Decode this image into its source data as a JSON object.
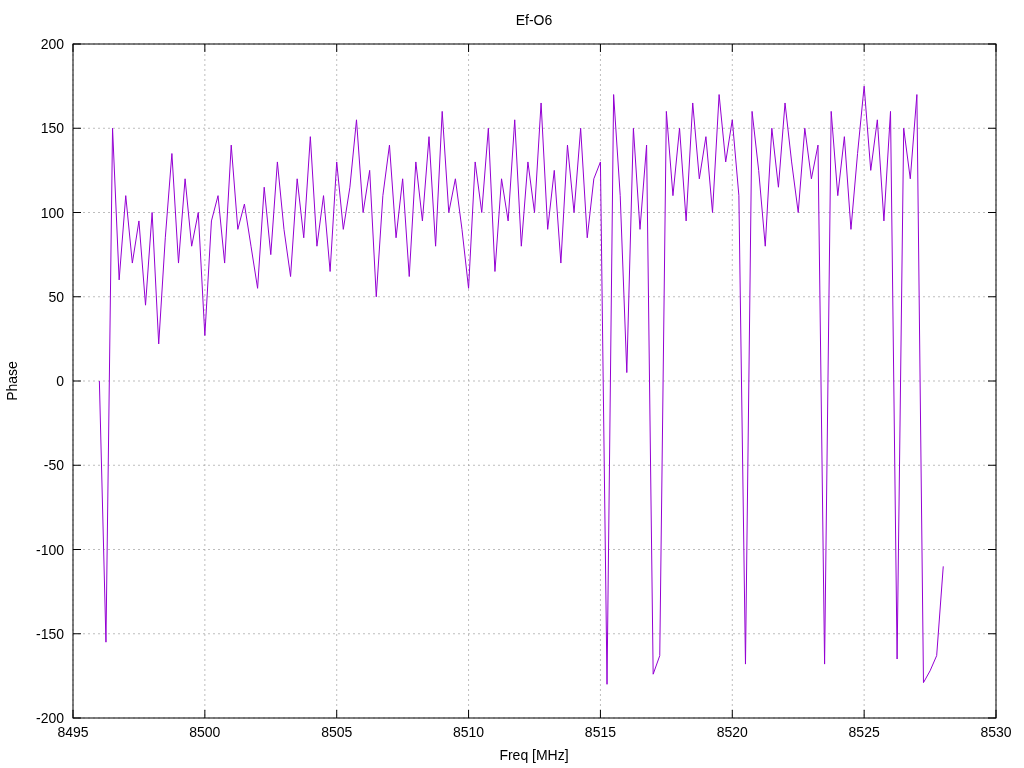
{
  "chart": {
    "chart_data": {
      "type": "line",
      "title": "Ef-O6",
      "xlabel": "Freq [MHz]",
      "ylabel": "Phase",
      "xlim": [
        8495,
        8530
      ],
      "ylim": [
        -200,
        200
      ],
      "xticks": [
        8495,
        8500,
        8505,
        8510,
        8515,
        8520,
        8525,
        8530
      ],
      "yticks": [
        -200,
        -150,
        -100,
        -50,
        0,
        50,
        100,
        150,
        200
      ],
      "x": [
        8496,
        8496.25,
        8496.5,
        8496.75,
        8497,
        8497.25,
        8497.5,
        8497.75,
        8498,
        8498.25,
        8498.5,
        8498.75,
        8499,
        8499.25,
        8499.5,
        8499.75,
        8500,
        8500.25,
        8500.5,
        8500.75,
        8501,
        8501.25,
        8501.5,
        8501.75,
        8502,
        8502.25,
        8502.5,
        8502.75,
        8503,
        8503.25,
        8503.5,
        8503.75,
        8504,
        8504.25,
        8504.5,
        8504.75,
        8505,
        8505.25,
        8505.5,
        8505.75,
        8506,
        8506.25,
        8506.5,
        8506.75,
        8507,
        8507.25,
        8507.5,
        8507.75,
        8508,
        8508.25,
        8508.5,
        8508.75,
        8509,
        8509.25,
        8509.5,
        8509.75,
        8510,
        8510.25,
        8510.5,
        8510.75,
        8511,
        8511.25,
        8511.5,
        8511.75,
        8512,
        8512.25,
        8512.5,
        8512.75,
        8513,
        8513.25,
        8513.5,
        8513.75,
        8514,
        8514.25,
        8514.5,
        8514.75,
        8515,
        8515.25,
        8515.5,
        8515.75,
        8516,
        8516.25,
        8516.5,
        8516.75,
        8517,
        8517.25,
        8517.5,
        8517.75,
        8518,
        8518.25,
        8518.5,
        8518.75,
        8519,
        8519.25,
        8519.5,
        8519.75,
        8520,
        8520.25,
        8520.5,
        8520.75,
        8521,
        8521.25,
        8521.5,
        8521.75,
        8522,
        8522.25,
        8522.5,
        8522.75,
        8523,
        8523.25,
        8523.5,
        8523.75,
        8524,
        8524.25,
        8524.5,
        8524.75,
        8525,
        8525.25,
        8525.5,
        8525.75,
        8526,
        8526.25,
        8526.5,
        8526.75,
        8527,
        8527.25,
        8527.5,
        8527.75,
        8528
      ],
      "grid": true,
      "series": [
        {
          "color": "#9400d3",
          "values": [
            0,
            -155,
            150,
            60,
            110,
            70,
            95,
            45,
            100,
            22,
            85,
            135,
            70,
            120,
            80,
            100,
            27,
            95,
            110,
            70,
            140,
            90,
            105,
            80,
            55,
            115,
            75,
            130,
            90,
            62,
            120,
            85,
            145,
            80,
            110,
            65,
            130,
            90,
            115,
            155,
            100,
            125,
            50,
            110,
            140,
            85,
            120,
            62,
            130,
            95,
            145,
            80,
            160,
            100,
            120,
            90,
            55,
            130,
            100,
            150,
            65,
            120,
            95,
            155,
            80,
            130,
            100,
            165,
            90,
            125,
            70,
            140,
            100,
            150,
            85,
            120,
            130,
            -180,
            170,
            110,
            5,
            150,
            90,
            140,
            -174,
            -163,
            160,
            110,
            150,
            95,
            165,
            120,
            145,
            100,
            170,
            130,
            155,
            110,
            -168,
            160,
            125,
            80,
            150,
            115,
            165,
            130,
            100,
            150,
            120,
            140,
            -168,
            160,
            110,
            145,
            90,
            135,
            175,
            125,
            155,
            95,
            160,
            -165,
            150,
            120,
            170,
            -179,
            -172,
            -163,
            -110
          ]
        }
      ]
    }
  }
}
